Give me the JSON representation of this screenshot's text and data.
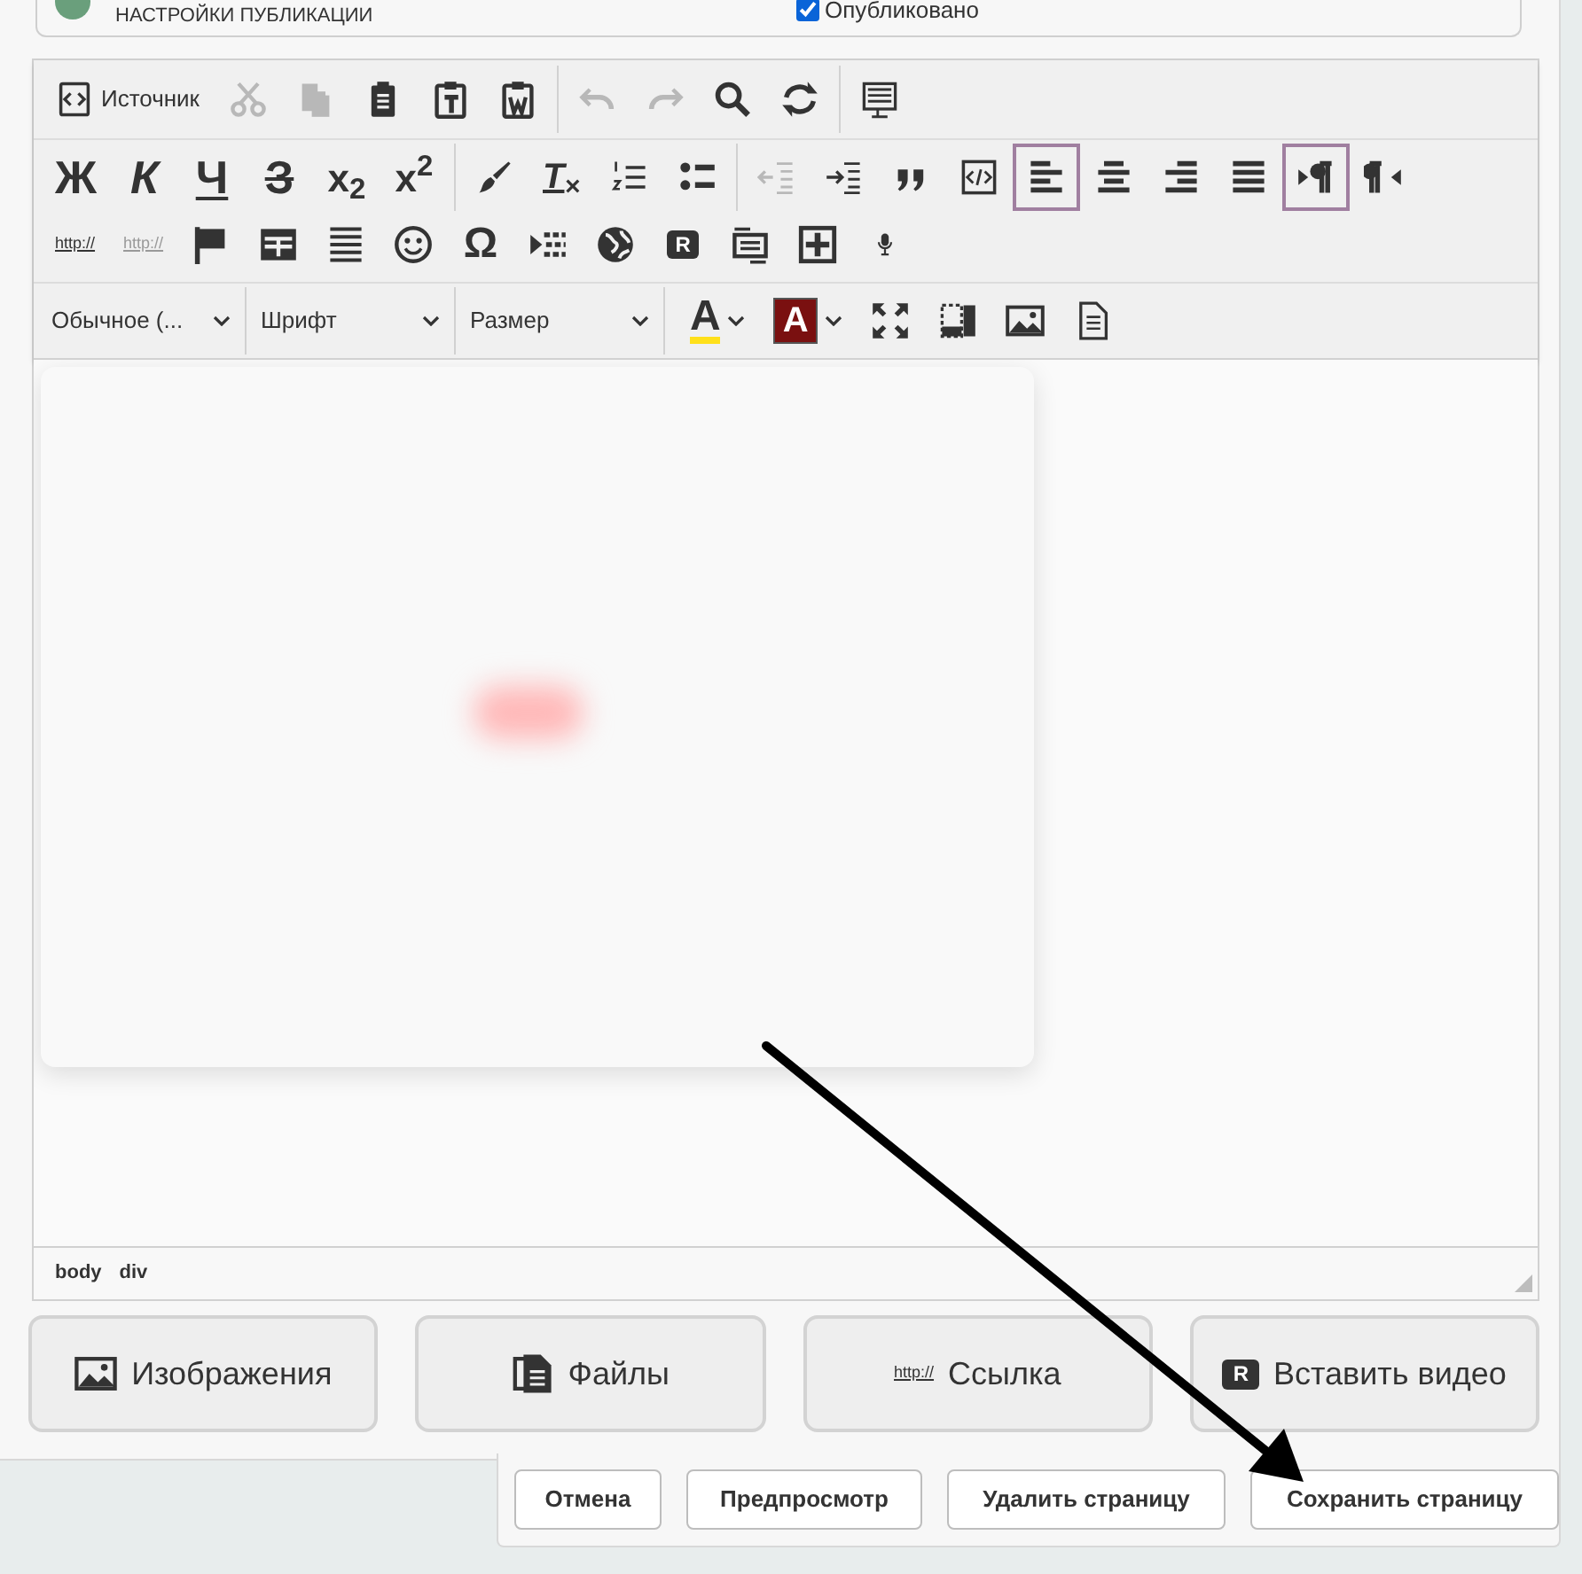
{
  "settings_card": {
    "title": "НАСТРОЙКИ ПУБЛИКАЦИИ",
    "published": {
      "label": "Опубликовано",
      "checked": true
    }
  },
  "toolbar": {
    "main_buttons": [
      {
        "kind": "icon",
        "label": "Источник",
        "disabled": false
      },
      {
        "kind": "icon",
        "disabled": true
      },
      {
        "kind": "icon",
        "disabled": true
      },
      {
        "kind": "icon",
        "disabled": false
      },
      {
        "kind": "icon",
        "disabled": false
      },
      {
        "kind": "icon",
        "disabled": false
      },
      {
        "kind": "sep"
      },
      {
        "kind": "icon",
        "disabled": true
      },
      {
        "kind": "icon",
        "disabled": true
      },
      {
        "kind": "icon",
        "disabled": false
      },
      {
        "kind": "icon",
        "disabled": false
      },
      {
        "kind": "sep"
      },
      {
        "kind": "icon",
        "disabled": false
      }
    ],
    "format_buttons": [
      {
        "kind": "bold",
        "text": "Ж",
        "disabled": false,
        "selected": false
      },
      {
        "kind": "italic",
        "text": "К",
        "disabled": false,
        "selected": false
      },
      {
        "kind": "underline",
        "text": "Ч",
        "disabled": false,
        "selected": false
      },
      {
        "kind": "strike",
        "text": "З",
        "disabled": false,
        "selected": false
      },
      {
        "kind": "plain",
        "text": "x$_{2}$",
        "disabled": false,
        "selected": false
      },
      {
        "kind": "plain",
        "text": "x$^{2}$",
        "disabled": false,
        "selected": false
      },
      {
        "kind": "sep"
      },
      {
        "kind": "icon",
        "disabled": false,
        "selected": false
      },
      {
        "kind": "clear",
        "text": "T$_{×}$",
        "disabled": false,
        "selected": false
      },
      {
        "kind": "icon",
        "disabled": false,
        "selected": false
      },
      {
        "kind": "icon",
        "disabled": false,
        "selected": false
      },
      {
        "kind": "sep"
      },
      {
        "kind": "icon",
        "disabled": true,
        "selected": false
      },
      {
        "kind": "icon",
        "disabled": false,
        "selected": false
      },
      {
        "kind": "icon",
        "disabled": false,
        "selected": false
      },
      {
        "kind": "icon",
        "disabled": false,
        "selected": false
      },
      {
        "kind": "icon",
        "disabled": false,
        "selected": true
      },
      {
        "kind": "icon",
        "disabled": false,
        "selected": false
      },
      {
        "kind": "icon",
        "disabled": false,
        "selected": false
      },
      {
        "kind": "icon",
        "disabled": false,
        "selected": false
      },
      {
        "kind": "icon",
        "disabled": false,
        "selected": true
      },
      {
        "kind": "icon",
        "disabled": false,
        "selected": false
      },
      {
        "kind": "link",
        "text": "http://",
        "disabled": false,
        "selected": false
      },
      {
        "kind": "link",
        "text": "http://",
        "disabled": true,
        "selected": false
      },
      {
        "kind": "icon",
        "disabled": false,
        "selected": false
      },
      {
        "kind": "icon",
        "disabled": false,
        "selected": false
      },
      {
        "kind": "icon",
        "disabled": false,
        "selected": false
      },
      {
        "kind": "icon",
        "disabled": false,
        "selected": false
      },
      {
        "kind": "omega",
        "text": "Ω",
        "disabled": false,
        "selected": false
      },
      {
        "kind": "icon",
        "disabled": false,
        "selected": false
      },
      {
        "kind": "icon",
        "disabled": false,
        "selected": false
      },
      {
        "kind": "badge",
        "text": "R",
        "disabled": false,
        "selected": false
      },
      {
        "kind": "icon",
        "disabled": false,
        "selected": false
      },
      {
        "kind": "icon",
        "disabled": false,
        "selected": false
      },
      {
        "kind": "icon",
        "disabled": false,
        "selected": false
      }
    ],
    "dropdowns": [
      "Обычное (...",
      "Шрифт",
      "Размер"
    ],
    "tools": [
      {
        "kind": "text-color",
        "text": "A"
      },
      {
        "kind": "background-color",
        "text": "A"
      },
      {
        "kind": "icon"
      },
      {
        "kind": "icon"
      },
      {
        "kind": "icon"
      },
      {
        "kind": "icon"
      }
    ]
  },
  "path": [
    "body",
    "div"
  ],
  "insert_buttons": [
    {
      "label": "Изображения"
    },
    {
      "label": "Файлы"
    },
    {
      "badge": "http://",
      "label": "Ссылка"
    },
    {
      "badge": "R",
      "label": "Вставить видео"
    }
  ],
  "actions": [
    "Отмена",
    "Предпросмотр",
    "Удалить страницу",
    "Сохранить страницу"
  ]
}
